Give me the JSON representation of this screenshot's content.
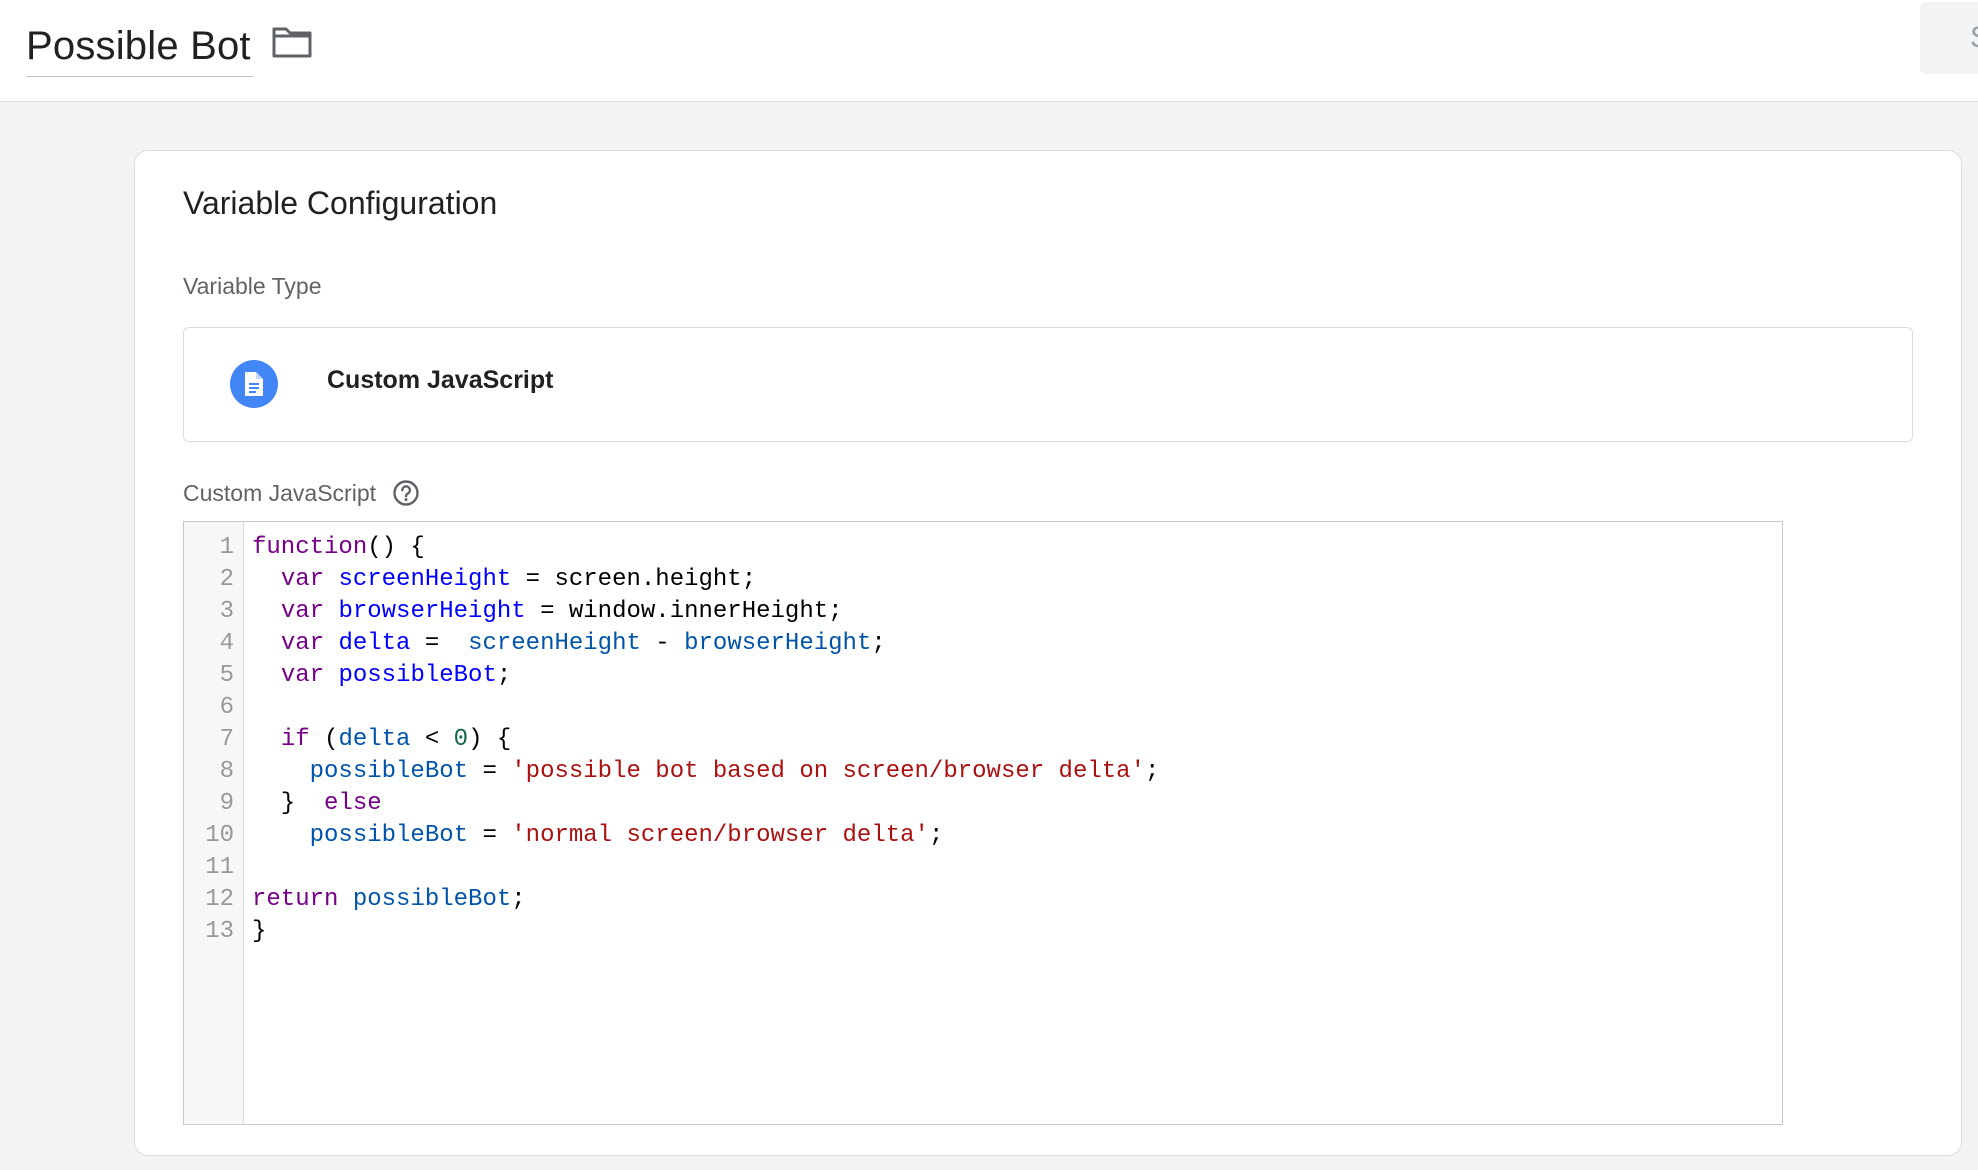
{
  "header": {
    "title": "Possible Bot",
    "save_label": "S"
  },
  "card": {
    "title": "Variable Configuration",
    "type_label": "Variable Type",
    "type_name": "Custom JavaScript",
    "code_label": "Custom JavaScript"
  },
  "icons": {
    "folder": "folder-icon",
    "variable_type": "document-icon",
    "help": "help-circle-icon"
  },
  "colors": {
    "accent": "#4285f4",
    "keyword": "#770088",
    "definition": "#0000ff",
    "variable": "#0055aa",
    "string": "#aa1111",
    "number": "#116644"
  },
  "editor": {
    "lines": [
      {
        "n": "1",
        "tokens": [
          [
            "kw",
            "function"
          ],
          [
            "",
            "() {"
          ]
        ]
      },
      {
        "n": "2",
        "tokens": [
          [
            "",
            "  "
          ],
          [
            "kw",
            "var"
          ],
          [
            "",
            " "
          ],
          [
            "def",
            "screenHeight"
          ],
          [
            "",
            " = screen.height;"
          ]
        ]
      },
      {
        "n": "3",
        "tokens": [
          [
            "",
            "  "
          ],
          [
            "kw",
            "var"
          ],
          [
            "",
            " "
          ],
          [
            "def",
            "browserHeight"
          ],
          [
            "",
            " = window.innerHeight;"
          ]
        ]
      },
      {
        "n": "4",
        "tokens": [
          [
            "",
            "  "
          ],
          [
            "kw",
            "var"
          ],
          [
            "",
            " "
          ],
          [
            "def",
            "delta"
          ],
          [
            "",
            " =  "
          ],
          [
            "var2",
            "screenHeight"
          ],
          [
            "",
            " - "
          ],
          [
            "var2",
            "browserHeight"
          ],
          [
            "",
            ";"
          ]
        ]
      },
      {
        "n": "5",
        "tokens": [
          [
            "",
            "  "
          ],
          [
            "kw",
            "var"
          ],
          [
            "",
            " "
          ],
          [
            "def",
            "possibleBot"
          ],
          [
            "",
            ";"
          ]
        ]
      },
      {
        "n": "6",
        "tokens": []
      },
      {
        "n": "7",
        "tokens": [
          [
            "",
            "  "
          ],
          [
            "kw",
            "if"
          ],
          [
            "",
            " ("
          ],
          [
            "var2",
            "delta"
          ],
          [
            "",
            " < "
          ],
          [
            "num",
            "0"
          ],
          [
            "",
            ") {"
          ]
        ]
      },
      {
        "n": "8",
        "tokens": [
          [
            "",
            "    "
          ],
          [
            "var2",
            "possibleBot"
          ],
          [
            "",
            " = "
          ],
          [
            "str",
            "'possible bot based on screen/browser delta'"
          ],
          [
            "",
            ";"
          ]
        ]
      },
      {
        "n": "9",
        "tokens": [
          [
            "",
            "  }  "
          ],
          [
            "kw",
            "else"
          ]
        ]
      },
      {
        "n": "10",
        "tokens": [
          [
            "",
            "    "
          ],
          [
            "var2",
            "possibleBot"
          ],
          [
            "",
            " = "
          ],
          [
            "str",
            "'normal screen/browser delta'"
          ],
          [
            "",
            ";"
          ]
        ]
      },
      {
        "n": "11",
        "tokens": []
      },
      {
        "n": "12",
        "tokens": [
          [
            "kw",
            "return"
          ],
          [
            "",
            " "
          ],
          [
            "var2",
            "possibleBot"
          ],
          [
            "",
            ";"
          ]
        ]
      },
      {
        "n": "13",
        "tokens": [
          [
            "",
            "}"
          ]
        ]
      }
    ]
  }
}
